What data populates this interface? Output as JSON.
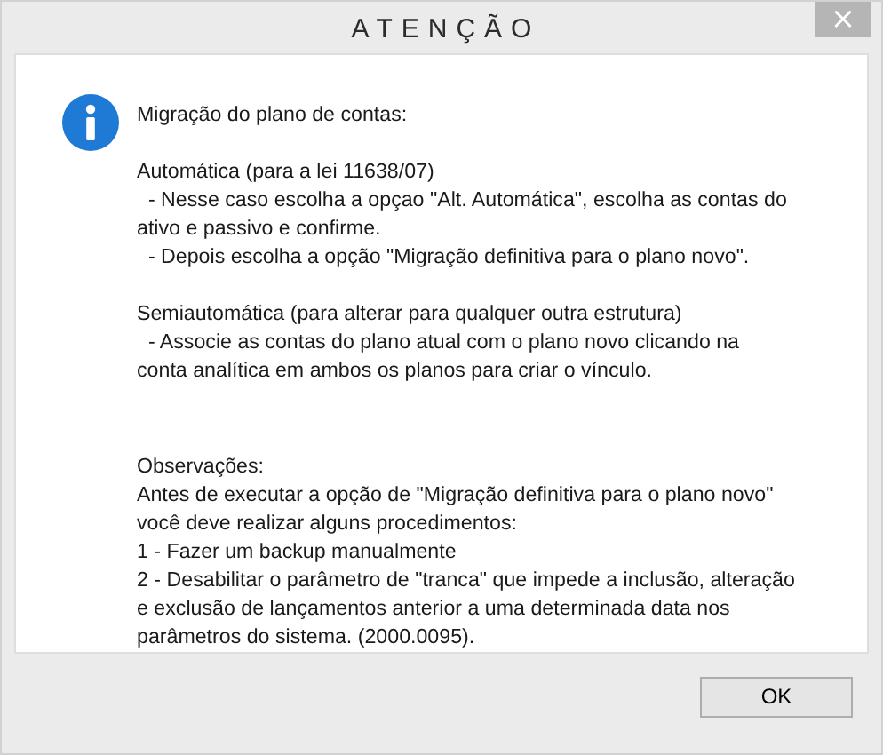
{
  "window": {
    "title": "ATENÇÃO",
    "close": "×"
  },
  "message": {
    "paragraphs": [
      {
        "lines": [
          "Migração do plano de contas:"
        ]
      },
      {
        "lines": [
          "Automática (para a lei 11638/07)",
          "  - Nesse caso escolha a opçao \"Alt. Automática\", escolha as contas do",
          "ativo e passivo e confirme.",
          "  - Depois escolha a opção \"Migração definitiva para o plano novo\"."
        ]
      },
      {
        "lines": [
          "Semiautomática (para alterar para qualquer outra estrutura)",
          "  - Associe as contas do plano atual com o plano novo clicando na",
          "conta analítica em ambos os planos para criar o vínculo."
        ]
      },
      {
        "lines": [
          "Observações:",
          "Antes de executar a opção de \"Migração definitiva para o plano novo\"",
          "você deve realizar alguns procedimentos:",
          "1 - Fazer um backup manualmente",
          "2 - Desabilitar o parâmetro de \"tranca\" que impede a inclusão, alteração",
          "e exclusão de lançamentos anterior a uma determinada data nos",
          "parâmetros do sistema. (2000.0095)."
        ]
      }
    ]
  },
  "buttons": [
    "OK"
  ]
}
